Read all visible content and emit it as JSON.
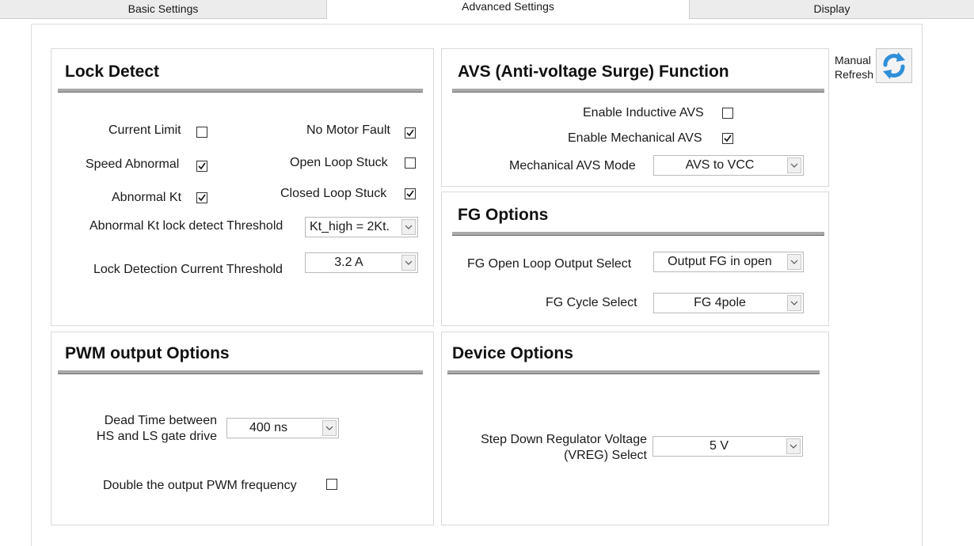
{
  "tabs": [
    {
      "label": "Basic Settings"
    },
    {
      "label": "Advanced Settings"
    },
    {
      "label": "Display"
    }
  ],
  "refresh": {
    "label_line1": "Manual",
    "label_line2": "Refresh"
  },
  "lock_detect": {
    "title": "Lock Detect",
    "current_limit": {
      "label": "Current Limit",
      "checked": false
    },
    "no_motor_fault": {
      "label": "No Motor Fault",
      "checked": true
    },
    "speed_abnormal": {
      "label": "Speed Abnormal",
      "checked": true
    },
    "open_loop_stuck": {
      "label": "Open Loop Stuck",
      "checked": false
    },
    "abnormal_kt": {
      "label": "Abnormal Kt",
      "checked": true
    },
    "closed_loop_stuck": {
      "label": "Closed Loop Stuck",
      "checked": true
    },
    "kt_threshold": {
      "label": "Abnormal Kt lock detect Threshold",
      "value": "Kt_high = 2Kt."
    },
    "current_threshold": {
      "label": "Lock Detection Current Threshold",
      "value": "3.2 A"
    }
  },
  "avs": {
    "title": "AVS (Anti-voltage Surge) Function",
    "enable_inductive": {
      "label": "Enable Inductive AVS",
      "checked": false
    },
    "enable_mechanical": {
      "label": "Enable Mechanical AVS",
      "checked": true
    },
    "mechanical_mode": {
      "label": "Mechanical AVS Mode",
      "value": "AVS to VCC"
    }
  },
  "fg": {
    "title": "FG Options",
    "open_loop_output": {
      "label": "FG Open Loop Output Select",
      "value": "Output FG in open"
    },
    "cycle_select": {
      "label": "FG Cycle Select",
      "value": "FG 4pole"
    }
  },
  "pwm": {
    "title": "PWM output Options",
    "dead_time": {
      "label_line1": "Dead Time between",
      "label_line2": "HS and LS gate drive",
      "value": "400 ns"
    },
    "double_freq": {
      "label": "Double the output PWM frequency",
      "checked": false
    }
  },
  "device": {
    "title": "Device Options",
    "vreg": {
      "label_line1": "Step Down Regulator Voltage",
      "label_line2": "(VREG) Select",
      "value": "5 V"
    }
  },
  "icons": {
    "checkmark": "check-icon",
    "dropdown": "chevron-down-icon",
    "refresh": "refresh-icon"
  },
  "colors": {
    "refresh_blue": "#2f8fd8"
  }
}
